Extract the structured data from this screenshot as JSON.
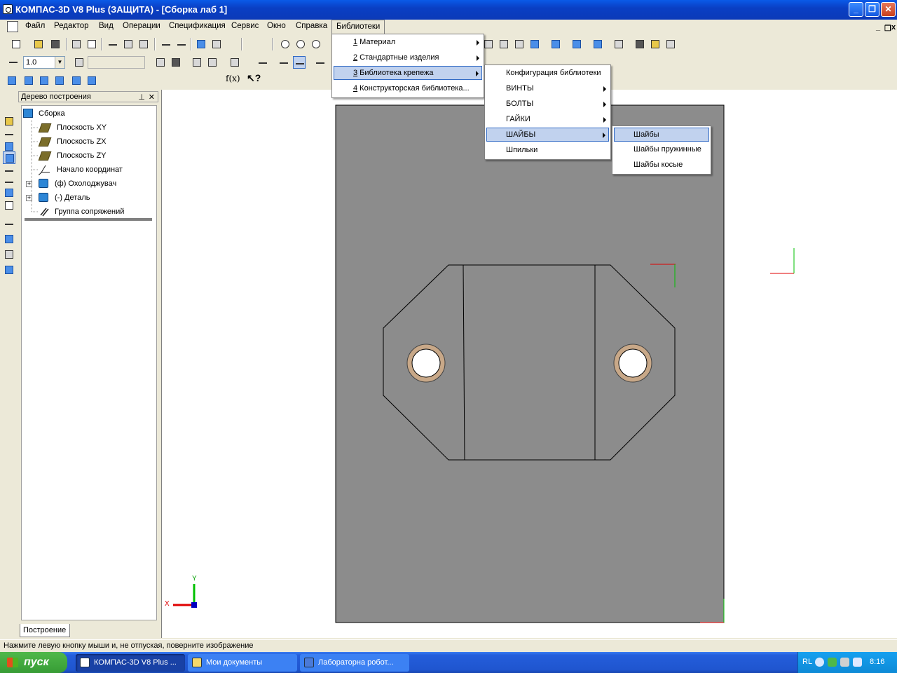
{
  "window": {
    "title": "КОМПАС-3D V8 Plus (ЗАЩИТА) - [Сборка лаб 1]",
    "min_label": "_",
    "max_label": "❐",
    "close_label": "✕"
  },
  "menubar": {
    "items": [
      "Файл",
      "Редактор",
      "Вид",
      "Операции",
      "Спецификация",
      "Сервис",
      "Окно",
      "Справка",
      "Библиотеки"
    ],
    "mdi_min": "_",
    "mdi_restore": "❐",
    "mdi_close": "x"
  },
  "toolbar": {
    "scale_value": "1.0"
  },
  "tree": {
    "header": "Дерево построения",
    "pin": "⊥",
    "close": "✕",
    "items": [
      {
        "label": "Сборка",
        "icon": "assembly-icon"
      },
      {
        "label": "Плоскость XY",
        "icon": "plane-icon"
      },
      {
        "label": "Плоскость ZX",
        "icon": "plane-icon"
      },
      {
        "label": "Плоскость ZY",
        "icon": "plane-icon"
      },
      {
        "label": "Начало координат",
        "icon": "origin-icon"
      },
      {
        "label": "(ф) Охолоджувач",
        "icon": "part-icon"
      },
      {
        "label": "(-) Деталь",
        "icon": "part-icon"
      },
      {
        "label": "Группа сопряжений",
        "icon": "mates-icon"
      }
    ],
    "tab": "Построение"
  },
  "menus": {
    "libraries": [
      {
        "num": "1",
        "label": " Материал",
        "has_sub": true
      },
      {
        "num": "2",
        "label": " Стандартные изделия",
        "has_sub": true
      },
      {
        "num": "3",
        "label": " Библиотека крепежа",
        "has_sub": true
      },
      {
        "num": "4",
        "label": " Конструкторская библиотека...",
        "has_sub": false
      }
    ],
    "fasteners": [
      {
        "label": "Конфигурация библиотеки",
        "has_sub": false
      },
      {
        "label": "ВИНТЫ",
        "has_sub": true
      },
      {
        "label": "БОЛТЫ",
        "has_sub": true
      },
      {
        "label": "ГАЙКИ",
        "has_sub": true
      },
      {
        "label": "ШАЙБЫ",
        "has_sub": true
      },
      {
        "label": "Шпильки",
        "has_sub": false
      }
    ],
    "washers": [
      {
        "label": "Шайбы"
      },
      {
        "label": "Шайбы пружинные"
      },
      {
        "label": "Шайбы косые"
      }
    ]
  },
  "viewport": {
    "axis_x": "X",
    "axis_y": "Y"
  },
  "status": {
    "text": "Нажмите левую кнопку мыши и, не отпуская, поверните изображение"
  },
  "taskbar": {
    "start": "пуск",
    "buttons": [
      "КОМПАС-3D V8 Plus ...",
      "Мои документы",
      "Лабораторна робот..."
    ],
    "lang": "RL",
    "clock": "8:16"
  },
  "colors": {
    "title_blue": "#0a3fc4",
    "plate_gray": "#8c8c8c",
    "menu_highlight": "#c1d2ee",
    "taskbar_blue": "#245edb"
  }
}
